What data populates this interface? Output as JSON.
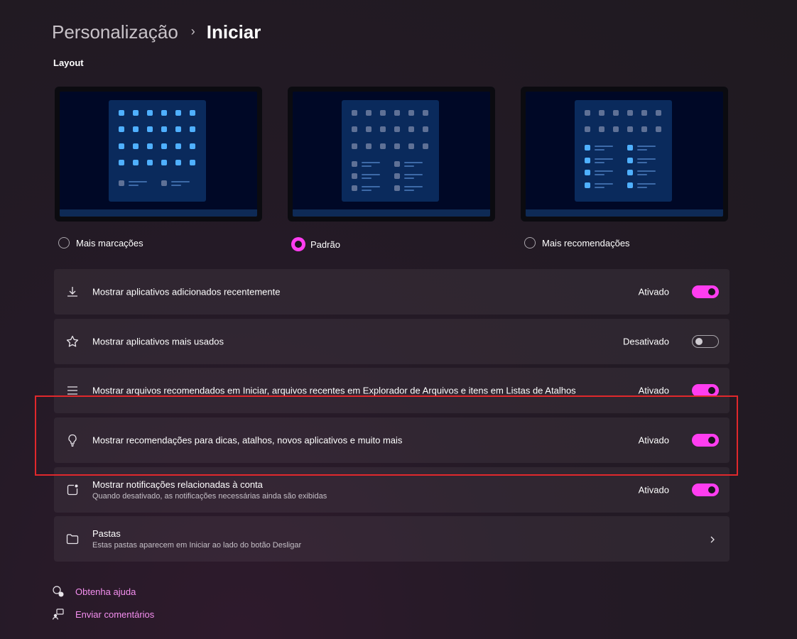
{
  "header": {
    "parent": "Personalização",
    "separator": "›",
    "current": "Iniciar"
  },
  "layout_section": {
    "label": "Layout",
    "options": [
      {
        "label": "Mais marcações",
        "selected": false
      },
      {
        "label": "Padrão",
        "selected": true
      },
      {
        "label": "Mais recomendações",
        "selected": false
      }
    ]
  },
  "settings": [
    {
      "icon": "download-icon",
      "title": "Mostrar aplicativos adicionados recentemente",
      "status": "Ativado",
      "on": true
    },
    {
      "icon": "star-icon",
      "title": "Mostrar aplicativos mais usados",
      "status": "Desativado",
      "on": false
    },
    {
      "icon": "list-icon",
      "title": "Mostrar arquivos recomendados em Iniciar, arquivos recentes em Explorador de Arquivos e itens em Listas de Atalhos",
      "status": "Ativado",
      "on": true
    },
    {
      "icon": "lightbulb-icon",
      "title": "Mostrar recomendações para dicas, atalhos, novos aplicativos e muito mais",
      "status": "Ativado",
      "on": true
    },
    {
      "icon": "notification-icon",
      "title": "Mostrar notificações relacionadas à conta",
      "subtitle": "Quando desativado, as notificações necessárias ainda são exibidas",
      "status": "Ativado",
      "on": true
    },
    {
      "icon": "folder-icon",
      "title": "Pastas",
      "subtitle": "Estas pastas aparecem em Iniciar ao lado do botão Desligar"
    }
  ],
  "footer": {
    "help": "Obtenha ajuda",
    "feedback": "Enviar comentários"
  },
  "colors": {
    "accent": "#ff3df0",
    "link": "#f58ff0",
    "highlight": "#e0282c",
    "tile_blue": "#4fb0ff",
    "tile_grey": "#5f7196"
  }
}
